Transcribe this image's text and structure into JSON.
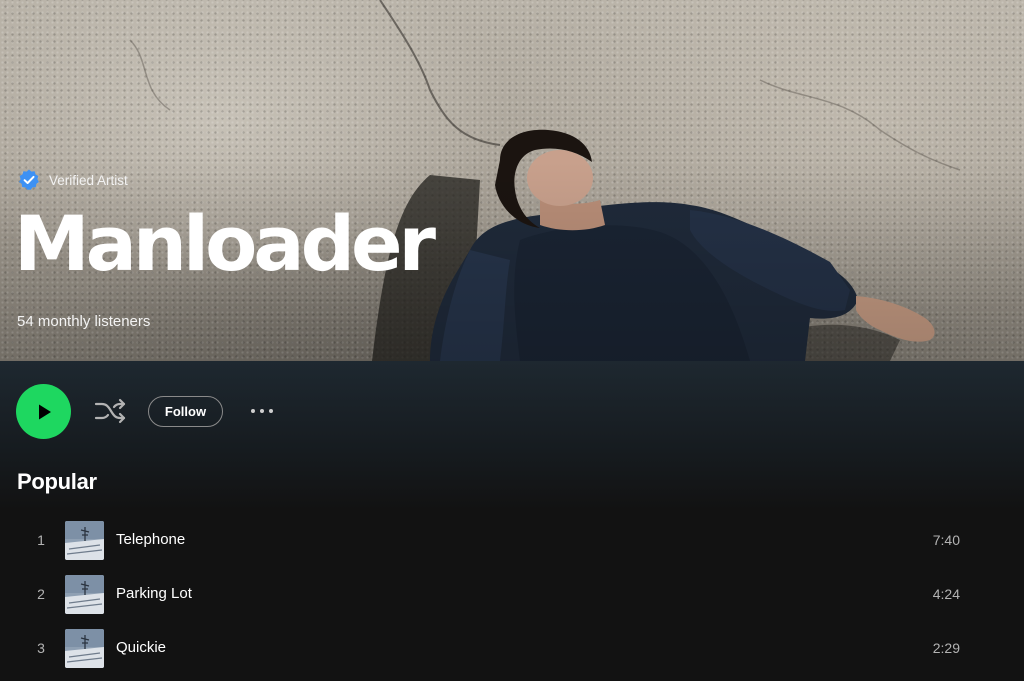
{
  "artist": {
    "verified_label": "Verified Artist",
    "name": "Manloader",
    "monthly_listeners": "54 monthly listeners"
  },
  "controls": {
    "play_icon": "play-icon",
    "shuffle_icon": "shuffle-icon",
    "follow_label": "Follow",
    "more_icon": "more-options-icon"
  },
  "popular": {
    "title": "Popular",
    "tracks": [
      {
        "number": "1",
        "title": "Telephone",
        "duration": "7:40"
      },
      {
        "number": "2",
        "title": "Parking Lot",
        "duration": "4:24"
      },
      {
        "number": "3",
        "title": "Quickie",
        "duration": "2:29"
      }
    ]
  },
  "colors": {
    "accent": "#1ed760",
    "verified_badge": "#3d91f4",
    "background": "#121212",
    "muted_text": "#b3b3b3"
  }
}
